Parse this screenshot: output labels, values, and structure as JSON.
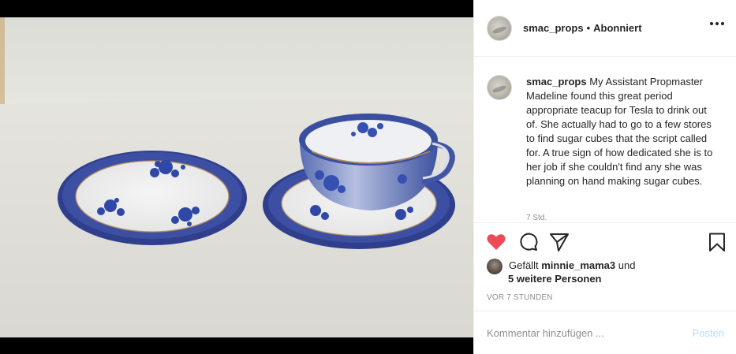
{
  "post": {
    "username": "smac_props",
    "separator": "•",
    "follow_state": "Abonniert",
    "caption_username": "smac_props",
    "caption": "My Assistant Propmaster Madeline found this great period appropriate teacup for Tesla to drink out of. She actually had to go to a few stores to find sugar cubes that the script called for. A true sign of how dedicated she is to her job if she couldn't find any she was planning on hand making sugar cubes.",
    "caption_age": "7 Std.",
    "likes_prefix": "Gefällt",
    "likes_user": "minnie_mama3",
    "likes_and": "und",
    "likes_others": "5 weitere Personen",
    "time_ago": "VOR 7 STUNDEN"
  },
  "comment_box": {
    "placeholder": "Kommentar hinzufügen ...",
    "post_label": "Posten"
  },
  "icons": {
    "like": "heart-icon",
    "comment": "comment-icon",
    "share": "share-icon",
    "save": "bookmark-icon",
    "more": "more-icon"
  },
  "colors": {
    "like_active": "#ed4956",
    "post_disabled": "#b2dffc",
    "muted_text": "#8e8e8e"
  }
}
